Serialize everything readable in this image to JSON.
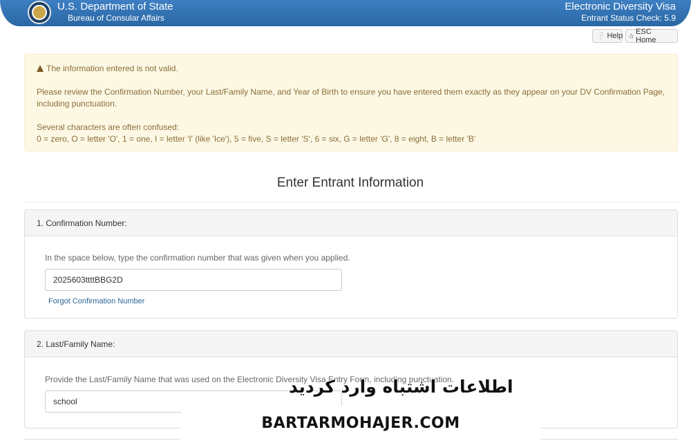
{
  "header": {
    "department": "U.S. Department of State",
    "bureau": "Bureau of Consular Affairs",
    "app_title": "Electronic Diversity Visa",
    "subtitle": "Entrant Status Check: 5.9"
  },
  "toolbar": {
    "help_label": "Help",
    "home_label": "ESC Home"
  },
  "alert": {
    "title": "The information entered is not valid.",
    "message": "Please review the Confirmation Number, your Last/Family Name, and Year of Birth to ensure you have entered them exactly as they appear on your DV Confirmation Page,",
    "message_cont": "including punctuation.",
    "confused_title": "Several characters are often confused:",
    "confused_list": "0 = zero, O = letter 'O', 1 = one, I = letter 'I' (like 'Ice'), 5 = five, S = letter 'S', 6 = six, G = letter 'G', 8 = eight, B = letter 'B'",
    "color": "#fcf8e3"
  },
  "page_title": "Enter Entrant Information",
  "sections": [
    {
      "heading": "1. Confirmation Number:",
      "description": "In the space below, type the confirmation number that was given when you applied.",
      "value": "2025603ttttBBG2D",
      "link": "Forgot Confirmation Number"
    },
    {
      "heading": "2. Last/Family Name:",
      "description": "Provide the Last/Family Name that was used on the Electronic Diversity Visa Entry Form, including punctuation.",
      "value": "school"
    }
  ],
  "overlay": {
    "persian_text": "اطلاعات اشتباه وارد کردید",
    "site": "BARTARMOHAJER.COM"
  },
  "colors": {
    "header": "#2b6aa8",
    "alert_text": "#8a6d3b",
    "link": "#2a6496"
  }
}
